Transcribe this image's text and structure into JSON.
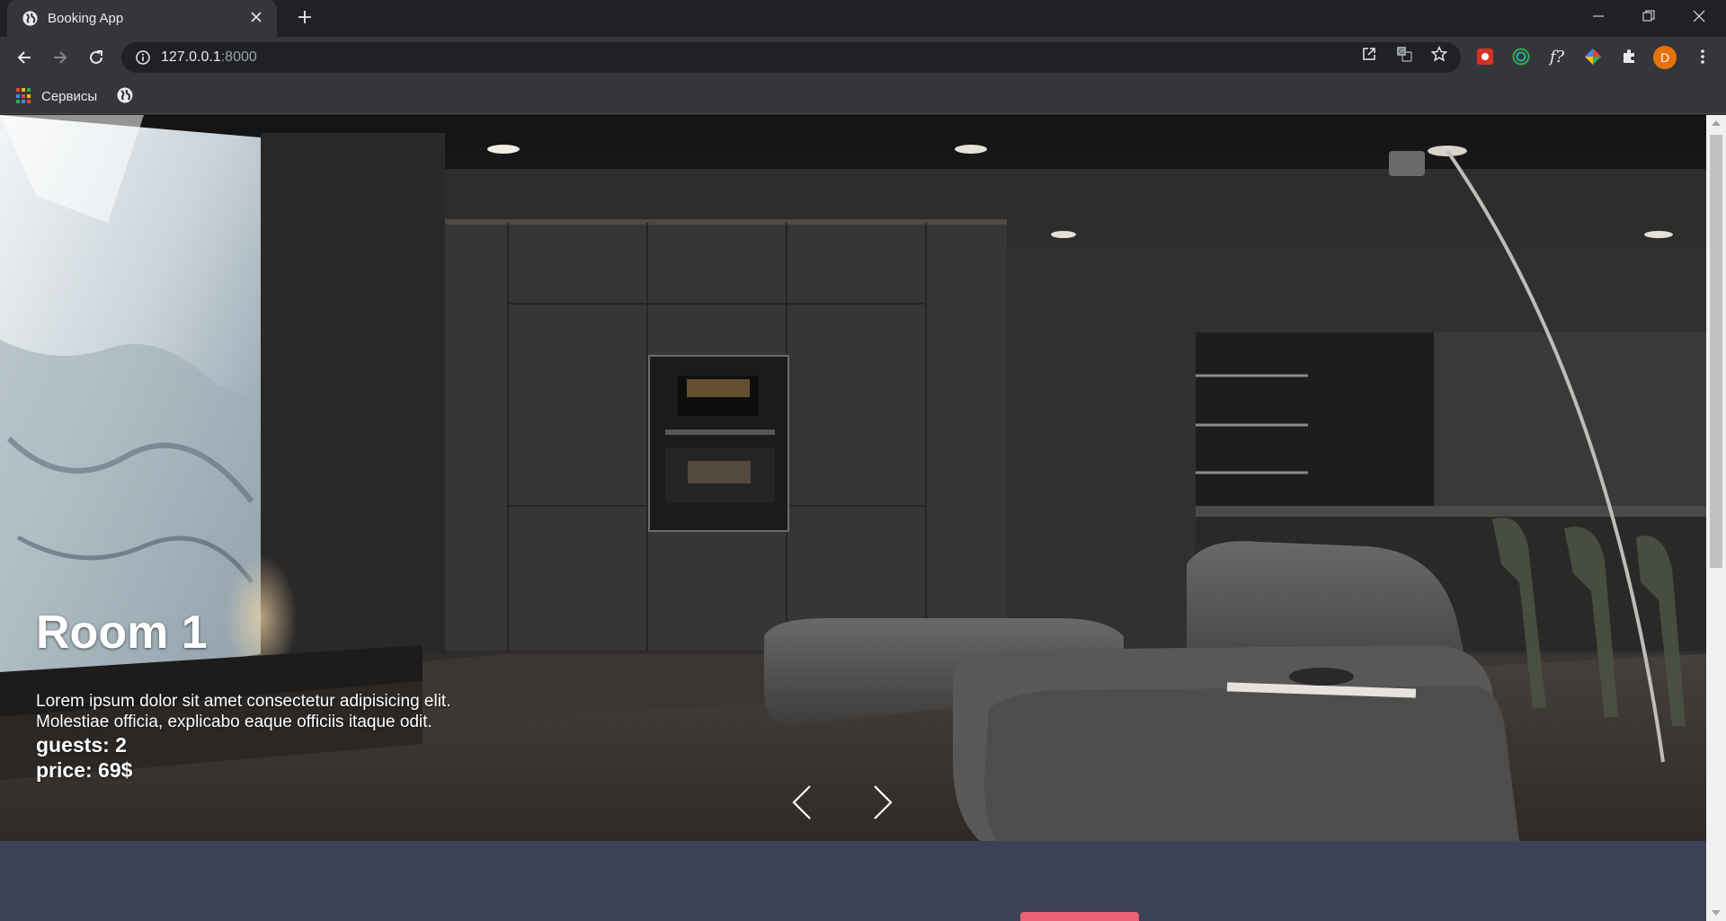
{
  "browser": {
    "tab_title": "Booking App",
    "url_host": "127.0.0.1",
    "url_port": ":8000",
    "avatar_letter": "D",
    "bookmarks": {
      "apps_label": "Сервисы"
    }
  },
  "hero": {
    "title": "Room 1",
    "description": "Lorem ipsum dolor sit amet consectetur adipisicing elit. Molestiae officia, explicabo eaque officiis itaque odit.",
    "guests": "guests: 2",
    "price": "price: 69$"
  },
  "colors": {
    "page_background": "#3d4155",
    "accent_button": "#ec6173",
    "chrome_dark": "#202124",
    "chrome_toolbar": "#35363a"
  },
  "icons": [
    "globe-icon",
    "close-icon",
    "plus-icon",
    "minimize-icon",
    "restore-icon",
    "back-icon",
    "forward-icon",
    "reload-icon",
    "info-icon",
    "open-external-icon",
    "translate-icon",
    "star-icon",
    "puzzle-icon",
    "menu-icon",
    "chevron-left-icon",
    "chevron-right-icon"
  ]
}
